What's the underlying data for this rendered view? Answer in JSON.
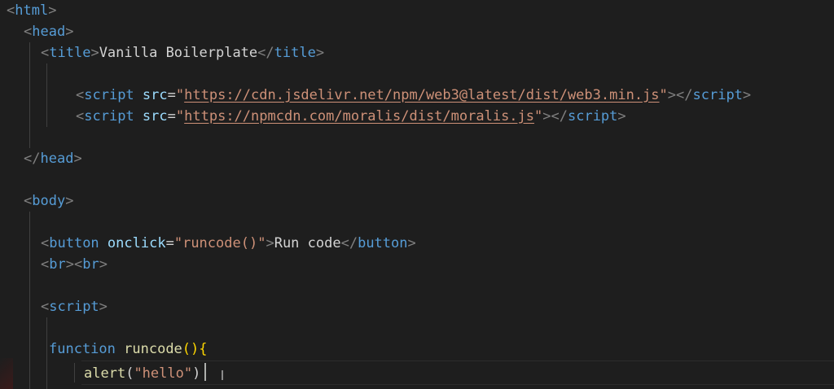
{
  "tags": {
    "html": "html",
    "head": "head",
    "title": "title",
    "script": "script",
    "body": "body",
    "button": "button",
    "br": "br"
  },
  "attrs": {
    "src": "src",
    "onclick": "onclick"
  },
  "title_text": "Vanilla Boilerplate",
  "script_src_web3": "https://cdn.jsdelivr.net/npm/web3@latest/dist/web3.min.js",
  "script_src_moralis": "https://npmcdn.com/moralis/dist/moralis.js",
  "button_onclick_value": "runcode()",
  "button_label": "Run code",
  "js": {
    "keyword_function": "function",
    "function_name": "runcode",
    "call_name": "alert",
    "call_arg": "\"hello\""
  },
  "colors": {
    "background": "#1e1e1e",
    "tag": "#569cd6",
    "attribute": "#9cdcfe",
    "string": "#ce9178",
    "function": "#dcdcaa",
    "bracket": "#808080"
  }
}
